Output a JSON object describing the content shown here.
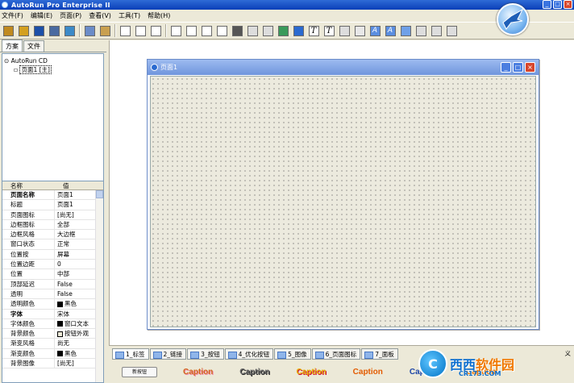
{
  "window": {
    "title": "AutoRun Pro Enterprise II",
    "btn_min": "_",
    "btn_max": "□",
    "btn_close": "×"
  },
  "menu": [
    "文件(F)",
    "编辑(E)",
    "页面(P)",
    "查看(V)",
    "工具(T)",
    "帮助(H)"
  ],
  "toolbar": {
    "icons": [
      "wand-icon",
      "open-icon",
      "save-icon",
      "search-icon",
      "globe-icon",
      "copy-icon",
      "paste-icon",
      "page-icon",
      "page-copy-icon",
      "page-plus-icon",
      "pointer-icon",
      "frame-icon",
      "frame2-icon",
      "frame3-icon",
      "grid-icon",
      "button-icon",
      "checkbox-icon",
      "image-icon",
      "flat-button-icon",
      "text-icon",
      "text2-icon",
      "edit-icon",
      "bar-icon",
      "a-icon",
      "a2-icon",
      "box-icon",
      "box2-icon",
      "misc-icon",
      "misc2-icon"
    ],
    "expand": "»"
  },
  "left": {
    "tabs": [
      "方案",
      "文件"
    ],
    "tree": {
      "root": "AutoRun CD",
      "child": "页面1 [主]"
    },
    "props": {
      "col_name": "名称",
      "col_value": "值",
      "rows": [
        {
          "k": "页面名称",
          "v": "页面1",
          "hdr": true
        },
        {
          "k": "标题",
          "v": "页面1"
        },
        {
          "k": "页面图标",
          "v": "[尚无]"
        },
        {
          "k": "边框图标",
          "v": "全部"
        },
        {
          "k": "边框风格",
          "v": "大边框"
        },
        {
          "k": "窗口状态",
          "v": "正常"
        },
        {
          "k": "位置按",
          "v": "屏幕"
        },
        {
          "k": "位置边距",
          "v": "0"
        },
        {
          "k": "位置",
          "v": "中部"
        },
        {
          "k": "顶部延迟",
          "v": "False"
        },
        {
          "k": "透明",
          "v": "False"
        },
        {
          "k": "透明颜色",
          "v": "黑色",
          "swatch": "#000000"
        },
        {
          "k": "字体",
          "v": "宋体",
          "hdr": true
        },
        {
          "k": "字体颜色",
          "v": "窗口文本",
          "swatch": "#000000"
        },
        {
          "k": "背景颜色",
          "v": "按钮外观",
          "swatch": "#ece9d8"
        },
        {
          "k": "渐变风格",
          "v": "尚无"
        },
        {
          "k": "渐变颜色",
          "v": "黑色",
          "swatch": "#000000"
        },
        {
          "k": "背景图像",
          "v": "[尚无]"
        }
      ]
    }
  },
  "designer": {
    "title": "页面1"
  },
  "bottom": {
    "tabs": [
      "1_标签",
      "2_链接",
      "3_按钮",
      "4_优化按钮",
      "5_图像",
      "6_页面图标",
      "7_面板"
    ],
    "tail": "义",
    "new_button": "新按钮",
    "captions": [
      "Caption",
      "Caption",
      "Caption",
      "Caption",
      "Caption",
      "Caption"
    ]
  },
  "watermark": {
    "mark": "C",
    "text_a": "西西",
    "text_b": "软件园",
    "url": "CR173.COM"
  },
  "colors": {
    "title_bar": "#0a3fb8",
    "accent": "#2e6bd6",
    "canvas": "#eceade"
  }
}
